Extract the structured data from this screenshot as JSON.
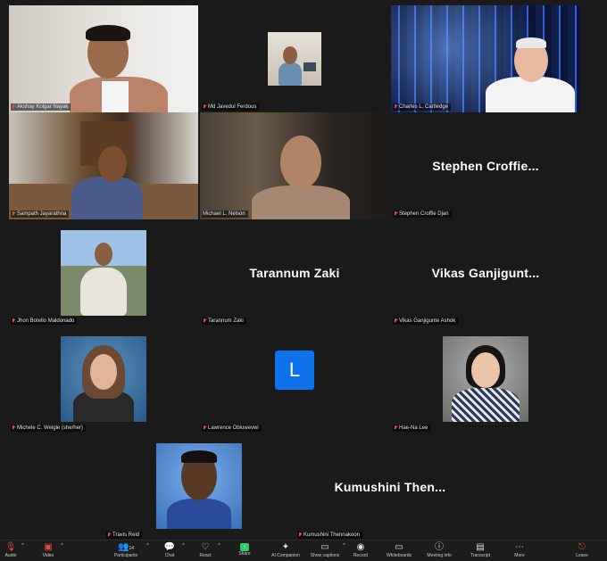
{
  "participants": [
    {
      "name": "Akshay Kolgar Nayak",
      "muted": true,
      "video": true
    },
    {
      "name": "Md Javedul Ferdous",
      "muted": true,
      "video": true
    },
    {
      "name": "Charles L. Cartledge",
      "muted": true,
      "video": true
    },
    {
      "name": "Sampath Jayarathna",
      "muted": true,
      "video": true
    },
    {
      "name": "Michael L. Nelson",
      "muted": false,
      "video": true,
      "active_speaker": true
    },
    {
      "name": "Stephen Croffie Djan",
      "display": "Stephen  Croffie...",
      "muted": true,
      "video": false
    },
    {
      "name": "Jhon Botello Maldonado",
      "muted": true,
      "video": true
    },
    {
      "name": "Tarannum Zaki",
      "display": "Tarannum Zaki",
      "muted": true,
      "video": false
    },
    {
      "name": "Vikas Ganjigunte Ashok",
      "display": "Vikas  Ganjigunt...",
      "muted": true,
      "video": false
    },
    {
      "name": "Michele C. Weigle (she/her)",
      "muted": true,
      "video": true
    },
    {
      "name": "Lawrence Obiuwevwi",
      "muted": true,
      "video": false,
      "avatar_letter": "L"
    },
    {
      "name": "Hae-Na Lee",
      "muted": true,
      "video": true
    },
    {
      "name": "Travis Reid",
      "muted": true,
      "video": true
    },
    {
      "name": "Kumushini Thennakoon",
      "display": "Kumushini  Then...",
      "muted": true,
      "video": false
    }
  ],
  "toolbar": {
    "audio": "Audio",
    "video": "Video",
    "participants": "Participants",
    "participants_count": "14",
    "chat": "Chat",
    "react": "React",
    "share": "Share",
    "ai_companion": "AI Companion",
    "captions": "Show captions",
    "record": "Record",
    "whiteboards": "Whiteboards",
    "meeting_info": "Meeting info",
    "transcript": "Transcript",
    "more": "More",
    "leave": "Leave"
  },
  "colors": {
    "background": "#1a1a1a",
    "active_speaker_border": "#2ecc71",
    "muted_icon": "#e84a4a",
    "avatar_blue": "#0e72ed",
    "share_green": "#2ecc71"
  }
}
